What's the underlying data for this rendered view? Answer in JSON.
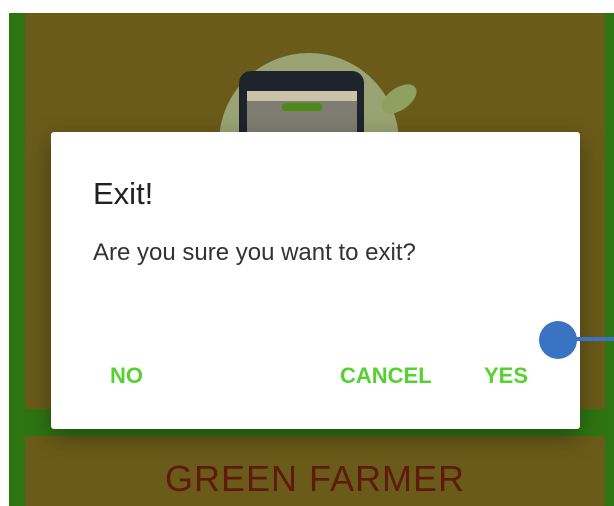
{
  "background_app": {
    "card_title": "GREEN FARMER"
  },
  "dialog": {
    "title": "Exit!",
    "message": "Are you sure you want to exit?",
    "buttons": {
      "no": "NO",
      "cancel": "CANCEL",
      "yes": "YES"
    }
  },
  "colors": {
    "accent_button": "#57d130",
    "app_background": "#2f7412",
    "card_background": "#6b5b1a",
    "touch_indicator": "#3a73c3"
  }
}
